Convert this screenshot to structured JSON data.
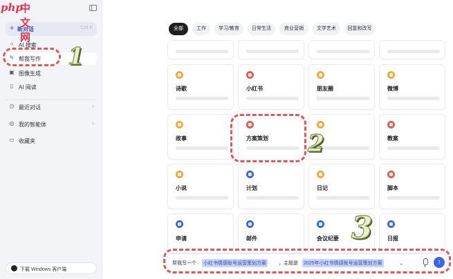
{
  "sidebar": {
    "new_chat": {
      "label": "新对话",
      "shortcut": "Ctrl K"
    },
    "items": [
      {
        "label": "AI 搜索",
        "icon": "search-icon"
      },
      {
        "label": "帮我写作",
        "icon": "pen-icon"
      },
      {
        "label": "图像生成",
        "icon": "image-icon"
      },
      {
        "label": "AI 阅读",
        "icon": "document-icon"
      },
      {
        "label": "最近对话",
        "icon": "history-icon"
      },
      {
        "label": "我的智能体",
        "icon": "agent-icon"
      },
      {
        "label": "收藏夹",
        "icon": "bookmark-icon"
      }
    ],
    "download_label": "下载 Windows 客户端"
  },
  "watermark": {
    "php": "php",
    "cn": "中文网"
  },
  "tabs": [
    "全部",
    "工作",
    "学习/教育",
    "日常生活",
    "商业营销",
    "文学艺术",
    "回复和改写"
  ],
  "cards": [
    {
      "title": "诗歌",
      "color": "orange"
    },
    {
      "title": "小红书",
      "color": "red"
    },
    {
      "title": "朋友圈",
      "color": "orange"
    },
    {
      "title": "微博",
      "color": "orange"
    },
    {
      "title": "故事",
      "color": "orange"
    },
    {
      "title": "方案策划",
      "color": "red"
    },
    {
      "title": "",
      "color": "orange"
    },
    {
      "title": "教案",
      "color": "red"
    },
    {
      "title": "小说",
      "color": "orange"
    },
    {
      "title": "计划",
      "color": "blue"
    },
    {
      "title": "日记",
      "color": "orange"
    },
    {
      "title": "脚本",
      "color": "red"
    },
    {
      "title": "申请",
      "color": "blue"
    },
    {
      "title": "邮件",
      "color": "blue"
    },
    {
      "title": "会议纪要",
      "color": "blue"
    },
    {
      "title": "日报",
      "color": "blue"
    }
  ],
  "input": {
    "prefix": "帮我写一个",
    "slot1": "小红书情感账号运营策划方案",
    "middle": "，主题是",
    "slot2": "2025年小红书情感账号运营策划方案",
    "suffix": "。"
  },
  "annotations": [
    "1",
    "2",
    "3"
  ],
  "colors": {
    "accent": "#3b66e8",
    "annotation": "#d95a5a",
    "orange": "#f2a53a",
    "red": "#e25a4d",
    "blue": "#3a63d8"
  }
}
